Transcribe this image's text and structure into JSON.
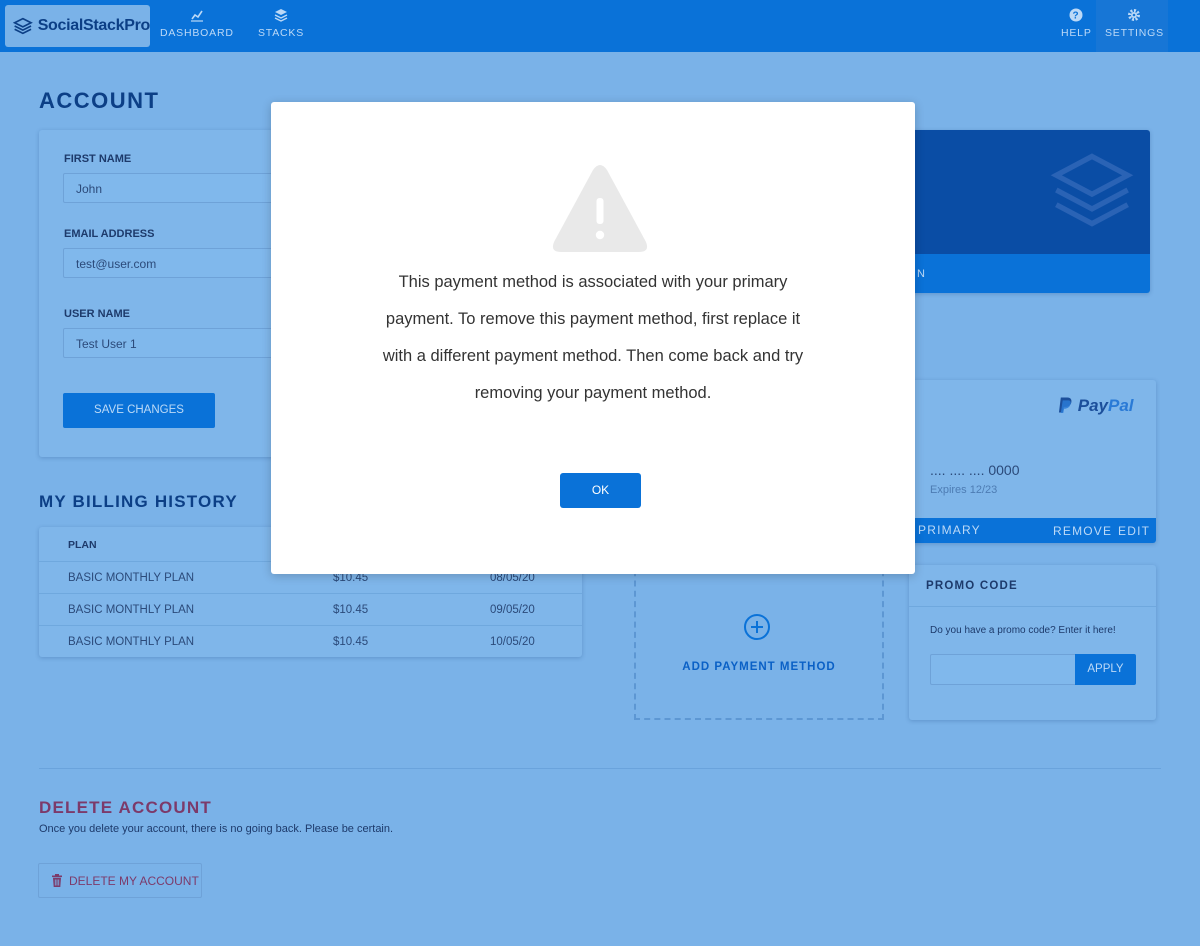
{
  "nav": {
    "logo": "SocialStackPro",
    "dashboard": "DASHBOARD",
    "stacks": "STACKS",
    "help": "HELP",
    "settings": "SETTINGS"
  },
  "account": {
    "title": "ACCOUNT",
    "first_name_label": "FIRST NAME",
    "first_name_value": "John",
    "email_label": "EMAIL ADDRESS",
    "email_value": "test@user.com",
    "username_label": "USER NAME",
    "username_value": "Test User 1",
    "save_label": "SAVE CHANGES"
  },
  "plan_card": {
    "footer_text_partial": "N"
  },
  "billing": {
    "title": "MY BILLING HISTORY",
    "header_plan": "PLAN",
    "rows": [
      {
        "plan": "BASIC MONTHLY PLAN",
        "amount": "$10.45",
        "date": "08/05/20"
      },
      {
        "plan": "BASIC MONTHLY PLAN",
        "amount": "$10.45",
        "date": "09/05/20"
      },
      {
        "plan": "BASIC MONTHLY PLAN",
        "amount": "$10.45",
        "date": "10/05/20"
      }
    ]
  },
  "payment": {
    "brand_pay": "Pay",
    "brand_pal": "Pal",
    "card_number": ".... .... .... 0000",
    "expires": "Expires 12/23",
    "primary": "PRIMARY",
    "remove": "REMOVE",
    "edit": "EDIT",
    "add_method": "ADD PAYMENT METHOD"
  },
  "promo": {
    "title": "PROMO CODE",
    "prompt": "Do you have a promo code? Enter it here!",
    "input_value": "",
    "apply": "APPLY"
  },
  "delete": {
    "title": "DELETE ACCOUNT",
    "subtitle": "Once you delete your account, there is no going back. Please be certain.",
    "button": "DELETE MY ACCOUNT"
  },
  "modal": {
    "message": "This payment method is associated with your primary payment. To remove this payment method, first replace it with a different payment method. Then come back and try removing your payment method.",
    "ok": "OK"
  },
  "colors": {
    "primary": "#0a72d8",
    "navy": "#0c3f86",
    "danger": "#7c3a6a",
    "overlay_bg": "#7ab2e8"
  }
}
